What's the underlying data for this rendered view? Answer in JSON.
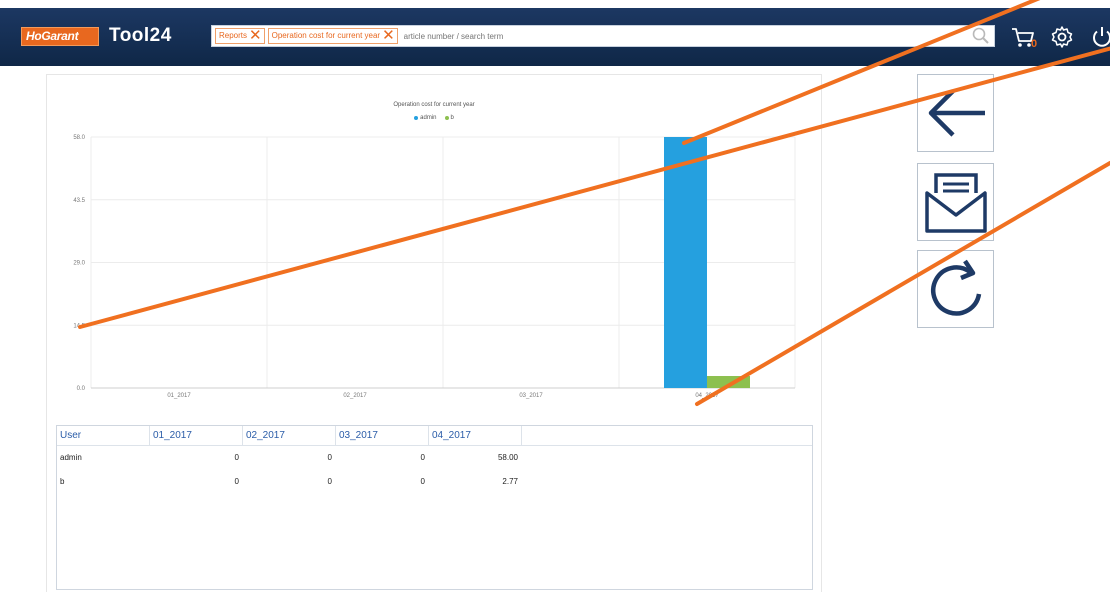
{
  "header": {
    "logo_text": "HoGarant",
    "app_name": "Tool24",
    "chips": [
      {
        "label": "Reports"
      },
      {
        "label": "Operation cost for current year"
      }
    ],
    "search_placeholder": "article number / search term",
    "cart_count": "0",
    "icons": [
      "search-icon",
      "cart-icon",
      "gear-icon",
      "power-icon"
    ],
    "accent_color": "#e8681f",
    "bar_color": "#1e3a66"
  },
  "chart_data": {
    "type": "bar",
    "title": "Operation cost for current year",
    "categories": [
      "01_2017",
      "02_2017",
      "03_2017",
      "04_2017"
    ],
    "series": [
      {
        "name": "admin",
        "values": [
          0,
          0,
          0,
          58.0
        ],
        "color": "#25a0df"
      },
      {
        "name": "b",
        "values": [
          0,
          0,
          0,
          2.77
        ],
        "color": "#8dc04f"
      }
    ],
    "yticks": [
      "0.0",
      "14.5",
      "29.0",
      "43.5",
      "58.0"
    ],
    "ylim": [
      0,
      58
    ],
    "grid": true,
    "legend_position": "top-center"
  },
  "table": {
    "headers": [
      "User",
      "01_2017",
      "02_2017",
      "03_2017",
      "04_2017"
    ],
    "rows": [
      {
        "user": "admin",
        "values": [
          "0",
          "0",
          "0",
          "58.00"
        ]
      },
      {
        "user": "b",
        "values": [
          "0",
          "0",
          "0",
          "2.77"
        ]
      }
    ]
  },
  "actions": [
    {
      "name": "back-button",
      "icon": "arrow-left-icon"
    },
    {
      "name": "email-button",
      "icon": "envelope-icon"
    },
    {
      "name": "refresh-button",
      "icon": "refresh-icon"
    }
  ],
  "annotation_color": "#f07020"
}
